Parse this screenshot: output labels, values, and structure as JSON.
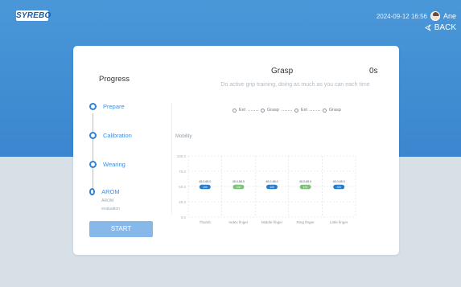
{
  "header": {
    "logo_text": "SYREBO",
    "datetime": "2024-09-12 16:56",
    "user_name": "Ane",
    "back_label": "BACK"
  },
  "sidebar": {
    "title": "Progress",
    "steps": [
      {
        "label": "Prepare",
        "sub": ""
      },
      {
        "label": "Calibration",
        "sub": ""
      },
      {
        "label": "Wearing",
        "sub": ""
      },
      {
        "label": "AROM",
        "sub": "AROM evaluation"
      }
    ],
    "start_label": "START"
  },
  "main": {
    "title": "Grasp",
    "timer": "0s",
    "description": "Do active grip training, doing as much as you can each time",
    "phases": [
      "Ext",
      "Grasp",
      "Ext",
      "Grasp"
    ]
  },
  "colors": {
    "accent": "#2b83d8",
    "pill_blue": "#2a7cc7",
    "pill_green": "#7dc07a",
    "header_bg": "#3f8bd3"
  },
  "chart_data": {
    "type": "bar",
    "title": "",
    "ylabel": "Mobility",
    "xlabel": "",
    "ylim": [
      0,
      100
    ],
    "yticks": [
      "0.0",
      "25.0",
      "50.0",
      "75.0",
      "100.0"
    ],
    "categories": [
      "Thumb",
      "Index finger",
      "Middle finger",
      "Ring finger",
      "Little finger"
    ],
    "range_labels": [
      "45.0-65.0",
      "45.0-65.0",
      "45.0-65.0",
      "45.0-65.0",
      "45.0-65.0"
    ],
    "values": [
      50,
      50,
      50,
      50,
      50
    ],
    "pill_labels": [
      "100",
      "100",
      "100",
      "100",
      "100"
    ],
    "pill_colors": [
      "blue",
      "green",
      "blue",
      "green",
      "blue"
    ],
    "grid": true
  }
}
